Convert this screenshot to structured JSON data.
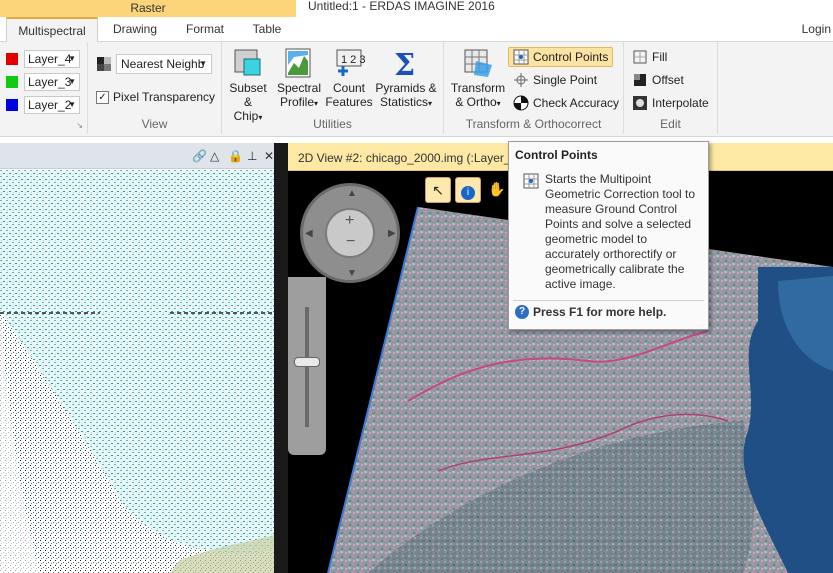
{
  "header": {
    "context_tab": "Raster",
    "window_title": "Untitled:1 - ERDAS IMAGINE 2016",
    "login": "Login"
  },
  "tabs": [
    {
      "label": "Multispectral",
      "active": true
    },
    {
      "label": "Drawing",
      "active": false
    },
    {
      "label": "Format",
      "active": false
    },
    {
      "label": "Table",
      "active": false
    }
  ],
  "ribbon": {
    "layers": [
      {
        "label": "Layer_4",
        "color": "#e00000"
      },
      {
        "label": "Layer_3",
        "color": "#10cc10"
      },
      {
        "label": "Layer_2",
        "color": "#0000e0"
      }
    ],
    "view": {
      "resample": "Nearest Neighb",
      "pixel_transparency": "Pixel Transparency",
      "label": "View"
    },
    "utilities": {
      "subset": [
        "Subset",
        "& Chip"
      ],
      "spectral": [
        "Spectral",
        "Profile"
      ],
      "count": [
        "Count",
        "Features"
      ],
      "pyramids": [
        "Pyramids &",
        "Statistics"
      ],
      "label": "Utilities"
    },
    "transform": {
      "transform": [
        "Transform",
        "& Ortho"
      ],
      "control_points": "Control Points",
      "single_point": "Single Point",
      "check_accuracy": "Check Accuracy",
      "label": "Transform & Orthocorrect"
    },
    "edit": {
      "fill": "Fill",
      "offset": "Offset",
      "interpolate": "Interpolate",
      "label": "Edit"
    }
  },
  "view2": {
    "title": "2D View #2: chicago_2000.img (:Layer_4)(:"
  },
  "tooltip": {
    "title": "Control Points",
    "body": "Starts the Multipoint Geometric Correction tool to measure Ground Control Points and solve a selected geometric model to accurately orthorectify or geometrically calibrate the active image.",
    "help": "Press F1 for more help."
  },
  "colors": {
    "accent": "#fcd57a",
    "view_header": "#fde9a3",
    "land": "#8a9a8f",
    "water": "#1f4f84"
  }
}
